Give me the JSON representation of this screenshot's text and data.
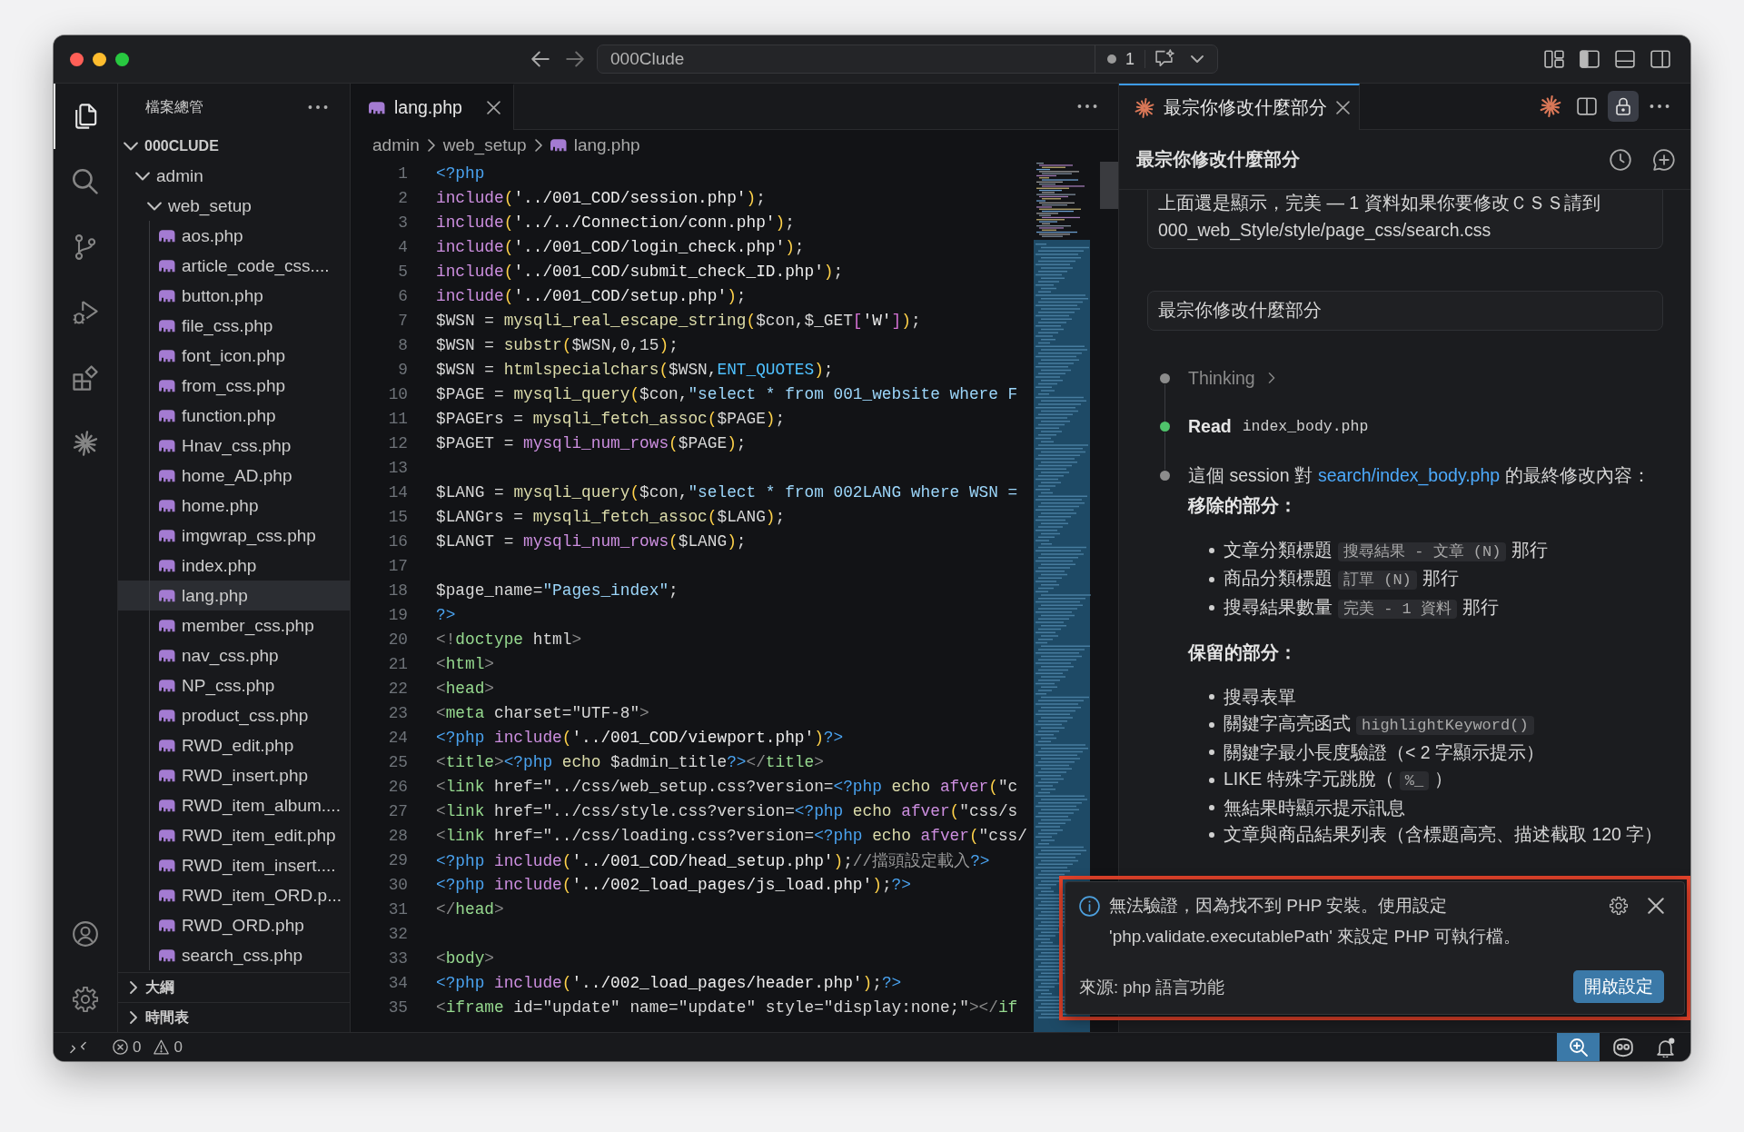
{
  "window": {
    "title": "000Clude",
    "count": "1",
    "layout": {
      "sidebar": true,
      "panel": false,
      "secondary_sidebar": false
    }
  },
  "activity_bar": {
    "items": [
      {
        "kind": "explorer",
        "selected": true
      },
      {
        "kind": "search",
        "selected": false
      },
      {
        "kind": "source_control",
        "selected": false
      },
      {
        "kind": "run_debug",
        "selected": false
      },
      {
        "kind": "extensions",
        "selected": false
      },
      {
        "kind": "claude",
        "selected": false
      }
    ],
    "bottom_items": [
      {
        "kind": "account"
      },
      {
        "kind": "settings"
      }
    ]
  },
  "sidebar": {
    "title": "檔案總管",
    "tree": [
      {
        "label": "000CLUDE",
        "kind": "folder",
        "expanded": true,
        "selected": false,
        "children": [
          {
            "label": "admin",
            "kind": "folder",
            "expanded": true,
            "selected": false,
            "children": [
              {
                "label": "web_setup",
                "kind": "folder",
                "expanded": true,
                "selected": false,
                "children": [
                  {
                    "label": "aos.php",
                    "kind": "php",
                    "selected": false
                  },
                  {
                    "label": "article_code_css....",
                    "kind": "php",
                    "selected": false
                  },
                  {
                    "label": "button.php",
                    "kind": "php",
                    "selected": false
                  },
                  {
                    "label": "file_css.php",
                    "kind": "php",
                    "selected": false
                  },
                  {
                    "label": "font_icon.php",
                    "kind": "php",
                    "selected": false
                  },
                  {
                    "label": "from_css.php",
                    "kind": "php",
                    "selected": false
                  },
                  {
                    "label": "function.php",
                    "kind": "php",
                    "selected": false
                  },
                  {
                    "label": "Hnav_css.php",
                    "kind": "php",
                    "selected": false
                  },
                  {
                    "label": "home_AD.php",
                    "kind": "php",
                    "selected": false
                  },
                  {
                    "label": "home.php",
                    "kind": "php",
                    "selected": false
                  },
                  {
                    "label": "imgwrap_css.php",
                    "kind": "php",
                    "selected": false
                  },
                  {
                    "label": "index.php",
                    "kind": "php",
                    "selected": false
                  },
                  {
                    "label": "lang.php",
                    "kind": "php",
                    "selected": true
                  },
                  {
                    "label": "member_css.php",
                    "kind": "php",
                    "selected": false
                  },
                  {
                    "label": "nav_css.php",
                    "kind": "php",
                    "selected": false
                  },
                  {
                    "label": "NP_css.php",
                    "kind": "php",
                    "selected": false
                  },
                  {
                    "label": "product_css.php",
                    "kind": "php",
                    "selected": false
                  },
                  {
                    "label": "RWD_edit.php",
                    "kind": "php",
                    "selected": false
                  },
                  {
                    "label": "RWD_insert.php",
                    "kind": "php",
                    "selected": false
                  },
                  {
                    "label": "RWD_item_album....",
                    "kind": "php",
                    "selected": false
                  },
                  {
                    "label": "RWD_item_edit.php",
                    "kind": "php",
                    "selected": false
                  },
                  {
                    "label": "RWD_item_insert....",
                    "kind": "php",
                    "selected": false
                  },
                  {
                    "label": "RWD_item_ORD.p...",
                    "kind": "php",
                    "selected": false
                  },
                  {
                    "label": "RWD_ORD.php",
                    "kind": "php",
                    "selected": false
                  },
                  {
                    "label": "search_css.php",
                    "kind": "php",
                    "selected": false
                  }
                ]
              }
            ]
          }
        ]
      }
    ],
    "sections": [
      {
        "label": "大綱",
        "expanded": false
      },
      {
        "label": "時間表",
        "expanded": false
      }
    ]
  },
  "editor": {
    "focused": false,
    "tabs": [
      {
        "label": "lang.php",
        "kind": "php",
        "selected": true
      }
    ],
    "breadcrumbs": [
      {
        "label": "admin",
        "kind": "folder"
      },
      {
        "label": "web_setup",
        "kind": "folder"
      },
      {
        "label": "lang.php",
        "kind": "php"
      }
    ],
    "lines": [
      {
        "number": "1",
        "tokens": [
          {
            "kind": "php",
            "text": "<?php"
          }
        ]
      },
      {
        "number": "2",
        "tokens": [
          {
            "kind": "kw",
            "text": "include"
          },
          {
            "kind": "paren",
            "text": "("
          },
          {
            "kind": "str",
            "text": "'../001_COD/session.php'"
          },
          {
            "kind": "paren",
            "text": ")"
          },
          {
            "kind": "plain",
            "text": ";"
          }
        ]
      },
      {
        "number": "3",
        "tokens": [
          {
            "kind": "kw",
            "text": "include"
          },
          {
            "kind": "paren",
            "text": "("
          },
          {
            "kind": "str",
            "text": "'../../Connection/conn.php'"
          },
          {
            "kind": "paren",
            "text": ")"
          },
          {
            "kind": "plain",
            "text": ";"
          }
        ]
      },
      {
        "number": "4",
        "tokens": [
          {
            "kind": "kw",
            "text": "include"
          },
          {
            "kind": "paren",
            "text": "("
          },
          {
            "kind": "str",
            "text": "'../001_COD/login_check.php'"
          },
          {
            "kind": "paren",
            "text": ")"
          },
          {
            "kind": "plain",
            "text": ";"
          }
        ]
      },
      {
        "number": "5",
        "tokens": [
          {
            "kind": "kw",
            "text": "include"
          },
          {
            "kind": "paren",
            "text": "("
          },
          {
            "kind": "str",
            "text": "'../001_COD/submit_check_ID.php'"
          },
          {
            "kind": "paren",
            "text": ")"
          },
          {
            "kind": "plain",
            "text": ";"
          }
        ]
      },
      {
        "number": "6",
        "tokens": [
          {
            "kind": "kw",
            "text": "include"
          },
          {
            "kind": "paren",
            "text": "("
          },
          {
            "kind": "str",
            "text": "'../001_COD/setup.php'"
          },
          {
            "kind": "paren",
            "text": ")"
          },
          {
            "kind": "plain",
            "text": ";"
          }
        ]
      },
      {
        "number": "7",
        "tokens": [
          {
            "kind": "plain",
            "text": "$WSN = "
          },
          {
            "kind": "func",
            "text": "mysqli_real_escape_string"
          },
          {
            "kind": "paren",
            "text": "("
          },
          {
            "kind": "plain",
            "text": "$con,$_GET"
          },
          {
            "kind": "bracket",
            "text": "["
          },
          {
            "kind": "str",
            "text": "'W'"
          },
          {
            "kind": "bracket",
            "text": "]"
          },
          {
            "kind": "paren",
            "text": ")"
          },
          {
            "kind": "plain",
            "text": ";"
          }
        ]
      },
      {
        "number": "8",
        "tokens": [
          {
            "kind": "plain",
            "text": "$WSN = "
          },
          {
            "kind": "func",
            "text": "substr"
          },
          {
            "kind": "paren",
            "text": "("
          },
          {
            "kind": "plain",
            "text": "$WSN,0,15"
          },
          {
            "kind": "paren",
            "text": ")"
          },
          {
            "kind": "plain",
            "text": ";"
          }
        ]
      },
      {
        "number": "9",
        "tokens": [
          {
            "kind": "plain",
            "text": "$WSN = "
          },
          {
            "kind": "func",
            "text": "htmlspecialchars"
          },
          {
            "kind": "paren",
            "text": "("
          },
          {
            "kind": "plain",
            "text": "$WSN,"
          },
          {
            "kind": "const",
            "text": "ENT_QUOTES"
          },
          {
            "kind": "paren",
            "text": ")"
          },
          {
            "kind": "plain",
            "text": ";"
          }
        ]
      },
      {
        "number": "10",
        "tokens": [
          {
            "kind": "plain",
            "text": "$PAGE = "
          },
          {
            "kind": "func",
            "text": "mysqli_query"
          },
          {
            "kind": "paren",
            "text": "("
          },
          {
            "kind": "plain",
            "text": "$con,"
          },
          {
            "kind": "dstr",
            "text": "\"select * from 001_website where F"
          }
        ]
      },
      {
        "number": "11",
        "tokens": [
          {
            "kind": "plain",
            "text": "$PAGErs = "
          },
          {
            "kind": "func",
            "text": "mysqli_fetch_assoc"
          },
          {
            "kind": "paren",
            "text": "("
          },
          {
            "kind": "plain",
            "text": "$PAGE"
          },
          {
            "kind": "paren",
            "text": ")"
          },
          {
            "kind": "plain",
            "text": ";"
          }
        ]
      },
      {
        "number": "12",
        "tokens": [
          {
            "kind": "plain",
            "text": "$PAGET = "
          },
          {
            "kind": "kw",
            "text": "mysqli_num_rows"
          },
          {
            "kind": "paren",
            "text": "("
          },
          {
            "kind": "plain",
            "text": "$PAGE"
          },
          {
            "kind": "paren",
            "text": ")"
          },
          {
            "kind": "plain",
            "text": ";"
          }
        ]
      },
      {
        "number": "13"
      },
      {
        "number": "14",
        "tokens": [
          {
            "kind": "plain",
            "text": "$LANG = "
          },
          {
            "kind": "func",
            "text": "mysqli_query"
          },
          {
            "kind": "paren",
            "text": "("
          },
          {
            "kind": "plain",
            "text": "$con,"
          },
          {
            "kind": "dstr",
            "text": "\"select * from 002LANG where WSN ="
          }
        ]
      },
      {
        "number": "15",
        "tokens": [
          {
            "kind": "plain",
            "text": "$LANGrs = "
          },
          {
            "kind": "func",
            "text": "mysqli_fetch_assoc"
          },
          {
            "kind": "paren",
            "text": "("
          },
          {
            "kind": "plain",
            "text": "$LANG"
          },
          {
            "kind": "paren",
            "text": ")"
          },
          {
            "kind": "plain",
            "text": ";"
          }
        ]
      },
      {
        "number": "16",
        "tokens": [
          {
            "kind": "plain",
            "text": "$LANGT = "
          },
          {
            "kind": "kw",
            "text": "mysqli_num_rows"
          },
          {
            "kind": "paren",
            "text": "("
          },
          {
            "kind": "plain",
            "text": "$LANG"
          },
          {
            "kind": "paren",
            "text": ")"
          },
          {
            "kind": "plain",
            "text": ";"
          }
        ]
      },
      {
        "number": "17"
      },
      {
        "number": "18",
        "tokens": [
          {
            "kind": "plain",
            "text": "$page_name="
          },
          {
            "kind": "dstr",
            "text": "\"Pages_index\""
          },
          {
            "kind": "plain",
            "text": ";"
          }
        ]
      },
      {
        "number": "19",
        "tokens": [
          {
            "kind": "php",
            "text": "?>"
          }
        ]
      },
      {
        "number": "20",
        "tokens": [
          {
            "kind": "punct",
            "text": "<!"
          },
          {
            "kind": "tag",
            "text": "doctype"
          },
          {
            "kind": "plain",
            "text": " html"
          },
          {
            "kind": "punct",
            "text": ">"
          }
        ]
      },
      {
        "number": "21",
        "tokens": [
          {
            "kind": "punct",
            "text": "<"
          },
          {
            "kind": "tag",
            "text": "html"
          },
          {
            "kind": "punct",
            "text": ">"
          }
        ]
      },
      {
        "number": "22",
        "tokens": [
          {
            "kind": "punct",
            "text": "<"
          },
          {
            "kind": "tag",
            "text": "head"
          },
          {
            "kind": "punct",
            "text": ">"
          }
        ]
      },
      {
        "number": "23",
        "tokens": [
          {
            "kind": "punct",
            "text": "<"
          },
          {
            "kind": "tag",
            "text": "meta"
          },
          {
            "kind": "plain",
            "text": " charset=\"UTF-8\""
          },
          {
            "kind": "punct",
            "text": ">"
          }
        ]
      },
      {
        "number": "24",
        "tokens": [
          {
            "kind": "php",
            "text": "<?php"
          },
          {
            "kind": "kw",
            "text": " include"
          },
          {
            "kind": "paren",
            "text": "("
          },
          {
            "kind": "str",
            "text": "'../001_COD/viewport.php'"
          },
          {
            "kind": "paren",
            "text": ")"
          },
          {
            "kind": "php",
            "text": "?>"
          }
        ]
      },
      {
        "number": "25",
        "tokens": [
          {
            "kind": "punct",
            "text": "<"
          },
          {
            "kind": "tag",
            "text": "title"
          },
          {
            "kind": "punct",
            "text": ">"
          },
          {
            "kind": "php",
            "text": "<?php"
          },
          {
            "kind": "func",
            "text": " echo"
          },
          {
            "kind": "plain",
            "text": " $admin_title"
          },
          {
            "kind": "php",
            "text": "?>"
          },
          {
            "kind": "punct",
            "text": "</"
          },
          {
            "kind": "tag",
            "text": "title"
          },
          {
            "kind": "punct",
            "text": ">"
          }
        ]
      },
      {
        "number": "26",
        "tokens": [
          {
            "kind": "punct",
            "text": "<"
          },
          {
            "kind": "tag",
            "text": "link"
          },
          {
            "kind": "plain",
            "text": " href=\"../css/web_setup.css?version="
          },
          {
            "kind": "php",
            "text": "<?php"
          },
          {
            "kind": "func",
            "text": " echo"
          },
          {
            "kind": "kw",
            "text": " afver"
          },
          {
            "kind": "paren",
            "text": "("
          },
          {
            "kind": "plain",
            "text": "\"c"
          }
        ]
      },
      {
        "number": "27",
        "tokens": [
          {
            "kind": "punct",
            "text": "<"
          },
          {
            "kind": "tag",
            "text": "link"
          },
          {
            "kind": "plain",
            "text": " href=\"../css/style.css?version="
          },
          {
            "kind": "php",
            "text": "<?php"
          },
          {
            "kind": "func",
            "text": " echo"
          },
          {
            "kind": "kw",
            "text": " afver"
          },
          {
            "kind": "paren",
            "text": "("
          },
          {
            "kind": "plain",
            "text": "\"css/s"
          }
        ]
      },
      {
        "number": "28",
        "tokens": [
          {
            "kind": "punct",
            "text": "<"
          },
          {
            "kind": "tag",
            "text": "link"
          },
          {
            "kind": "plain",
            "text": " href=\"../css/loading.css?version="
          },
          {
            "kind": "php",
            "text": "<?php"
          },
          {
            "kind": "func",
            "text": " echo"
          },
          {
            "kind": "kw",
            "text": " afver"
          },
          {
            "kind": "paren",
            "text": "("
          },
          {
            "kind": "plain",
            "text": "\"css/"
          }
        ]
      },
      {
        "number": "29",
        "tokens": [
          {
            "kind": "php",
            "text": "<?php"
          },
          {
            "kind": "kw",
            "text": " include"
          },
          {
            "kind": "paren",
            "text": "("
          },
          {
            "kind": "str",
            "text": "'../001_COD/head_setup.php'"
          },
          {
            "kind": "paren",
            "text": ")"
          },
          {
            "kind": "plain",
            "text": ";"
          },
          {
            "kind": "comment",
            "text": "//擋頭設定載入"
          },
          {
            "kind": "php",
            "text": "?>"
          }
        ]
      },
      {
        "number": "30",
        "tokens": [
          {
            "kind": "php",
            "text": "<?php"
          },
          {
            "kind": "kw",
            "text": " include"
          },
          {
            "kind": "paren",
            "text": "("
          },
          {
            "kind": "str",
            "text": "'../002_load_pages/js_load.php'"
          },
          {
            "kind": "paren",
            "text": ")"
          },
          {
            "kind": "plain",
            "text": ";"
          },
          {
            "kind": "php",
            "text": "?>"
          }
        ]
      },
      {
        "number": "31",
        "tokens": [
          {
            "kind": "punct",
            "text": "</"
          },
          {
            "kind": "tag",
            "text": "head"
          },
          {
            "kind": "punct",
            "text": ">"
          }
        ]
      },
      {
        "number": "32"
      },
      {
        "number": "33",
        "tokens": [
          {
            "kind": "punct",
            "text": "<"
          },
          {
            "kind": "tag",
            "text": "body"
          },
          {
            "kind": "punct",
            "text": ">"
          }
        ]
      },
      {
        "number": "34",
        "tokens": [
          {
            "kind": "php",
            "text": "<?php"
          },
          {
            "kind": "kw",
            "text": " include"
          },
          {
            "kind": "paren",
            "text": "("
          },
          {
            "kind": "str",
            "text": "'../002_load_pages/header.php'"
          },
          {
            "kind": "paren",
            "text": ")"
          },
          {
            "kind": "plain",
            "text": ";"
          },
          {
            "kind": "php",
            "text": "?>"
          }
        ]
      },
      {
        "number": "35",
        "tokens": [
          {
            "kind": "punct",
            "text": "<"
          },
          {
            "kind": "tag",
            "text": "iframe"
          },
          {
            "kind": "plain",
            "text": " id=\"update\" name=\"update\" style=\"display:none;\""
          },
          {
            "kind": "punct",
            "text": "></"
          },
          {
            "kind": "tag",
            "text": "if"
          }
        ]
      }
    ]
  },
  "chat": {
    "focused": true,
    "tabs": [
      {
        "label": "最宗你修改什麼部分",
        "kind": "claude",
        "selected": true
      }
    ],
    "locked": true,
    "title": "最宗你修改什麼部分",
    "messages": [
      {
        "text": "上面還是顯示，完美 — 1 資料如果你要修改ＣＳＳ請到 000_web_Style/style/page_css/search.css"
      },
      {
        "text": "最宗你修改什麼部分"
      }
    ],
    "steps": [
      {
        "kind": "thinking",
        "label": "Thinking",
        "color": "#8c8c8c"
      },
      {
        "kind": "tool",
        "label": "Read",
        "target": "index_body.php",
        "color": "#4fc26b"
      },
      {
        "kind": "answer",
        "color": "#8c8c8c",
        "before": "這個 session 對",
        "link": "search/index_body.php",
        "after": "的最終修改內容：",
        "sections": [
          {
            "heading": "移除的部分：",
            "items": [
              {
                "text": "文章分類標題",
                "code": "搜尋結果 - 文章 (N)",
                "after": "那行"
              },
              {
                "text": "商品分類標題",
                "code": "訂單 (N)",
                "after": "那行"
              },
              {
                "text": "搜尋結果數量",
                "code": "完美 - 1 資料",
                "after": "那行"
              }
            ]
          },
          {
            "heading": "保留的部分：",
            "items": [
              {
                "text": "搜尋表單"
              },
              {
                "text": "關鍵字高亮函式",
                "code": "highlightKeyword()"
              },
              {
                "text": "關鍵字最小長度驗證（< 2 字顯示提示）"
              },
              {
                "text": "LIKE 特殊字元跳脫（",
                "code": "%_",
                "after": "）"
              },
              {
                "text": "無結果時顯示提示訊息"
              },
              {
                "text": "文章與商品結果列表（含標題高亮、描述截取 120 字）"
              }
            ]
          }
        ]
      }
    ]
  },
  "notification": {
    "highlighted": true,
    "message": "無法驗證，因為找不到 PHP 安裝。使用設定 'php.validate.executablePath' 來設定 PHP 可執行檔。",
    "source": "來源: php 語言功能",
    "button": "開啟設定"
  },
  "status_bar": {
    "errors": "0",
    "warnings": "0",
    "zoom_active": true,
    "notifications_unread": true
  }
}
